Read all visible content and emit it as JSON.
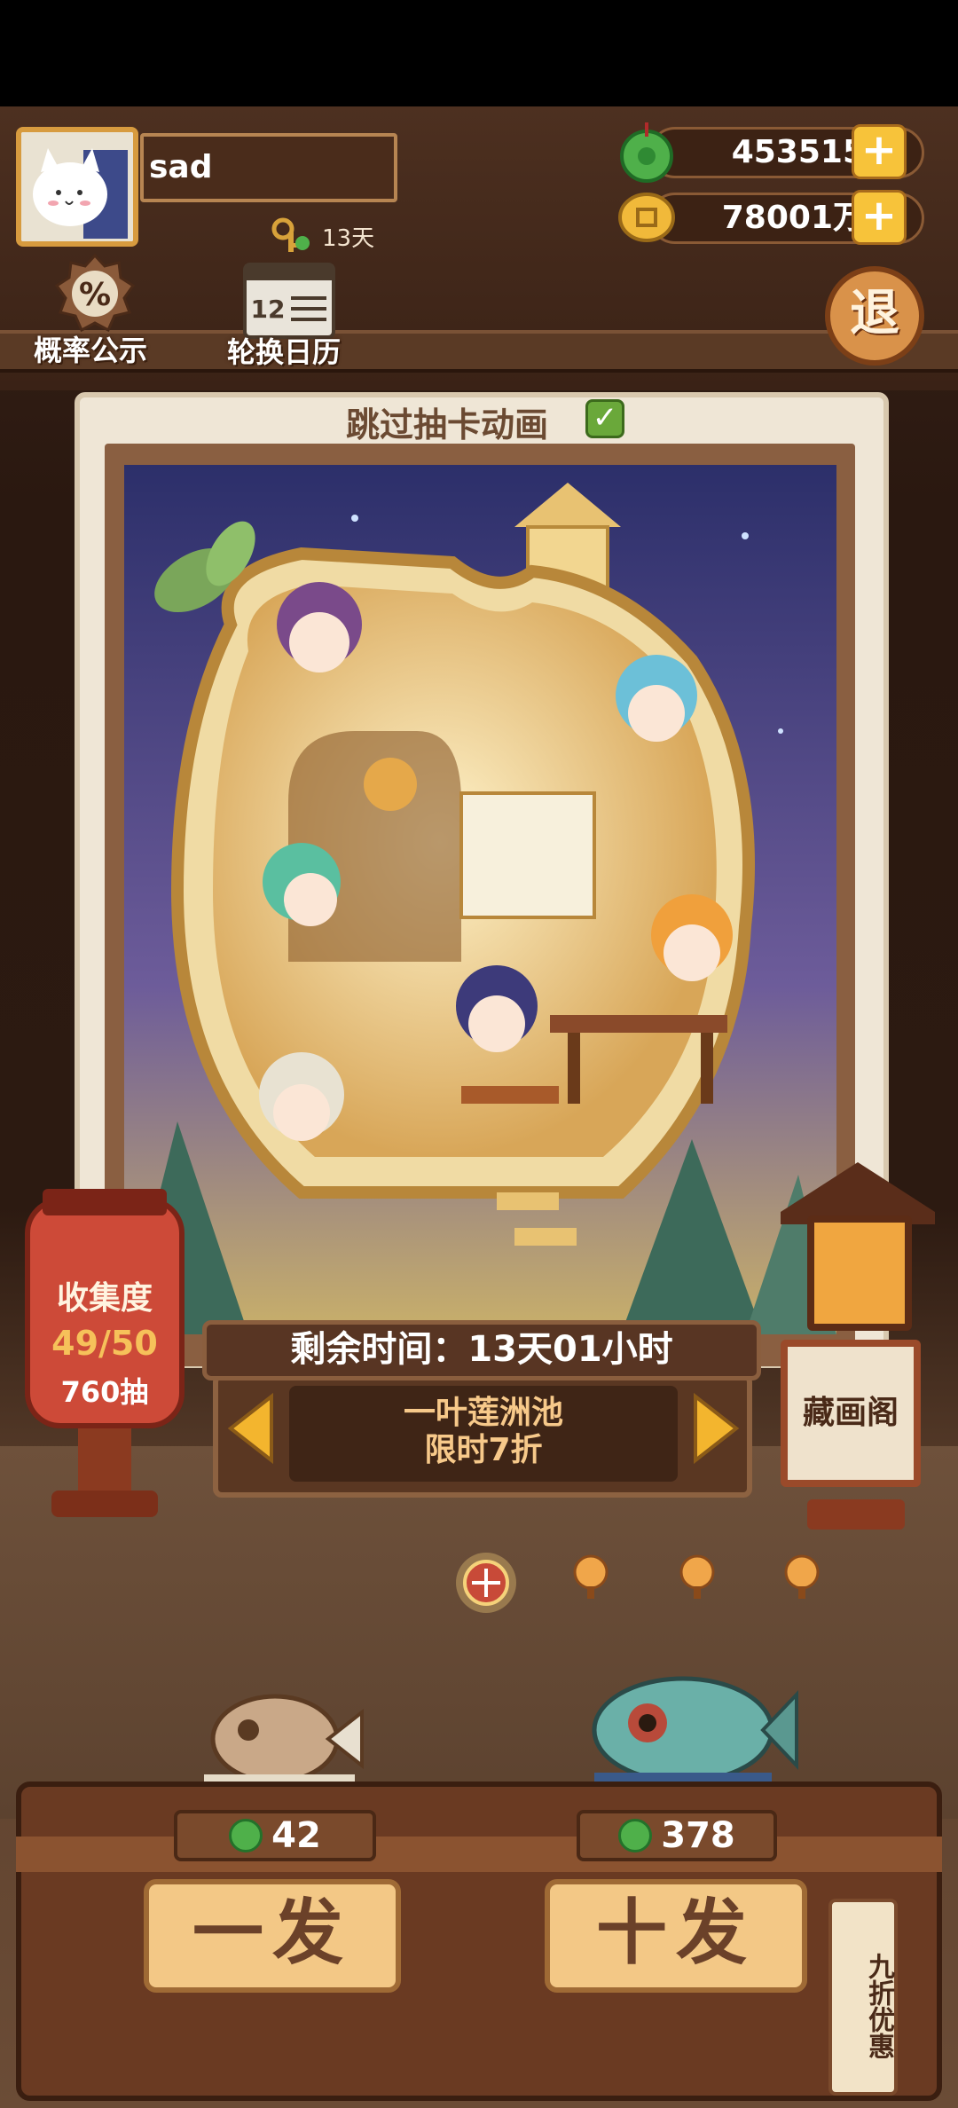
{
  "player": {
    "name": "sad",
    "key_days": "13天"
  },
  "currency": {
    "jade": "453515",
    "coins": "78001万"
  },
  "top_icons": {
    "probability_label": "概率公示",
    "probability_symbol": "%",
    "calendar_label": "轮换日历",
    "calendar_number": "12"
  },
  "exit_label": "退",
  "skip_animation": {
    "label": "跳过抽卡动画",
    "checked": true
  },
  "collection": {
    "label": "收集度",
    "progress": "49/50",
    "draws": "760抽"
  },
  "timer": "剩余时间：13天01小时",
  "pool": {
    "line1": "一叶莲洲池",
    "line2": "限时7折"
  },
  "pavilion_label": "藏画阁",
  "pull": {
    "single": {
      "label": "一发",
      "price": "42"
    },
    "ten": {
      "label": "十发",
      "price": "378"
    }
  },
  "discount_tag": "九折优惠",
  "page_dots": {
    "count": 4,
    "active": 0
  },
  "colors": {
    "accent": "#f7c33a",
    "jade": "#4fb04a",
    "wood": "#6a3a22",
    "button": "#f3c886"
  }
}
